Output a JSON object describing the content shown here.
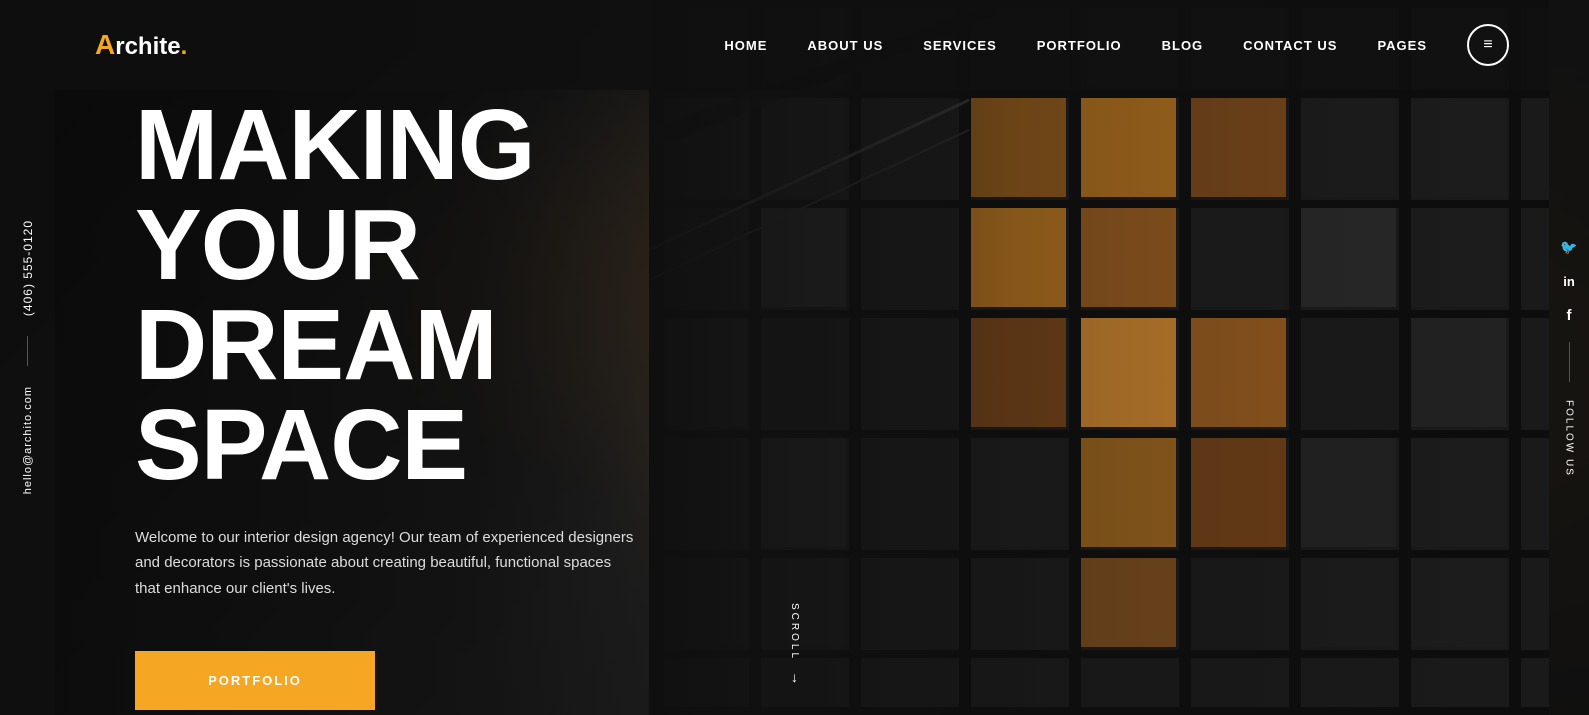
{
  "logo": {
    "letter_a": "A",
    "rest": "rchite",
    "dot": "."
  },
  "nav": {
    "links": [
      {
        "id": "home",
        "label": "HOME"
      },
      {
        "id": "about",
        "label": "ABOUT US"
      },
      {
        "id": "services",
        "label": "SERVICES"
      },
      {
        "id": "portfolio",
        "label": "PORTFOLIO"
      },
      {
        "id": "blog",
        "label": "BLOG"
      },
      {
        "id": "contact",
        "label": "CONTACT US"
      },
      {
        "id": "pages",
        "label": "PAGES"
      }
    ],
    "menu_icon": "≡"
  },
  "sidebar_left": {
    "phone": "(406) 555-0120",
    "email": "hello@archito.com"
  },
  "sidebar_right": {
    "follow_label": "FOLLOW US",
    "social": [
      {
        "id": "twitter",
        "icon": "🐦"
      },
      {
        "id": "linkedin",
        "icon": "in"
      },
      {
        "id": "facebook",
        "icon": "f"
      }
    ]
  },
  "hero": {
    "title_line1": "MAKING YOUR",
    "title_line2": "DREAM SPACE",
    "subtitle": "Welcome to our interior design agency! Our team of experienced designers and decorators is passionate about creating beautiful, functional spaces that enhance our client's lives.",
    "cta_label": "PORTFOLIO"
  },
  "scroll": {
    "label": "SCROLL",
    "arrow": "↓"
  },
  "colors": {
    "accent": "#f5a623",
    "bg_dark": "#0a0a0a",
    "text_white": "#ffffff"
  }
}
